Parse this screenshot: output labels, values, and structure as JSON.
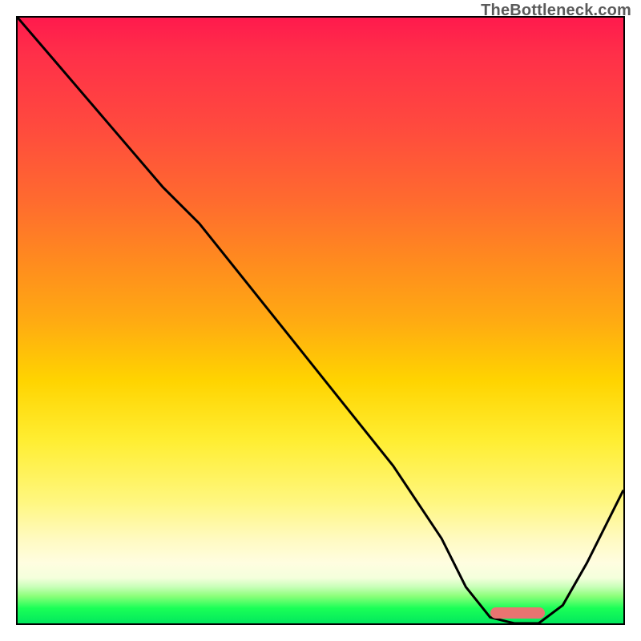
{
  "watermark": "TheBottleneck.com",
  "colors": {
    "gradient_top": "#ff1a4d",
    "gradient_mid_orange": "#ff8a1f",
    "gradient_yellow": "#ffee33",
    "gradient_green": "#02e85d",
    "curve": "#000000",
    "marker": "#e97471",
    "border": "#000000"
  },
  "chart_data": {
    "type": "line",
    "title": "",
    "xlabel": "",
    "ylabel": "",
    "xlim": [
      0,
      100
    ],
    "ylim": [
      0,
      100
    ],
    "grid": false,
    "legend": false,
    "series": [
      {
        "name": "bottleneck-curve",
        "x": [
          0,
          6,
          12,
          18,
          24,
          30,
          38,
          46,
          54,
          62,
          70,
          74,
          78,
          82,
          86,
          90,
          94,
          100
        ],
        "y": [
          100,
          93,
          86,
          79,
          72,
          66,
          56,
          46,
          36,
          26,
          14,
          6,
          1,
          0,
          0,
          3,
          10,
          22
        ]
      }
    ],
    "annotations": [
      {
        "name": "sweet-spot-marker",
        "x_start": 78,
        "x_end": 87,
        "y": 0
      }
    ]
  }
}
